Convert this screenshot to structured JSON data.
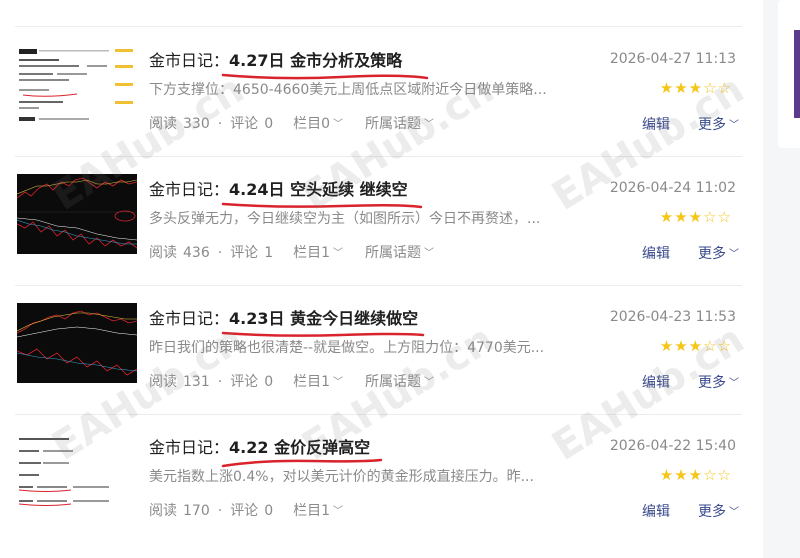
{
  "articles": [
    {
      "prefix": "金市日记：",
      "title_main": "4.27日 金市分析及策略",
      "datetime": "2026-04-27 11:13",
      "excerpt": "下方支撑位：4650-4660美元上周低点区域附近今日做单策略...",
      "rating": 3,
      "read_label": "阅读",
      "read_count": "330",
      "comment_label": "评论",
      "comment_count": "0",
      "category": "栏目0",
      "topic": "所属话题",
      "edit": "编辑",
      "more": "更多",
      "thumb_type": "text"
    },
    {
      "prefix": "金市日记：",
      "title_main": "4.24日 空头延续 继续空",
      "datetime": "2026-04-24 11:02",
      "excerpt": "多头反弹无力，今日继续空为主（如图所示）今日不再赘述，...",
      "rating": 3,
      "read_label": "阅读",
      "read_count": "436",
      "comment_label": "评论",
      "comment_count": "1",
      "category": "栏目1",
      "topic": "所属话题",
      "edit": "编辑",
      "more": "更多",
      "thumb_type": "chart"
    },
    {
      "prefix": "金市日记：",
      "title_main": "4.23日 黄金今日继续做空",
      "datetime": "2026-04-23 11:53",
      "excerpt": "昨日我们的策略也很清楚--就是做空。上方阻力位：4770美元...",
      "rating": 3,
      "read_label": "阅读",
      "read_count": "131",
      "comment_label": "评论",
      "comment_count": "0",
      "category": "栏目1",
      "topic": "所属话题",
      "edit": "编辑",
      "more": "更多",
      "thumb_type": "chart"
    },
    {
      "prefix": "金市日记：",
      "title_main": "4.22 金价反弹高空",
      "datetime": "2026-04-22 15:40",
      "excerpt": "美元指数上涨0.4%，对以美元计价的黄金形成直接压力。昨...",
      "rating": 3,
      "read_label": "阅读",
      "read_count": "170",
      "comment_label": "评论",
      "comment_count": "0",
      "category": "栏目1",
      "topic": "",
      "edit": "编辑",
      "more": "更多",
      "thumb_type": "text"
    }
  ],
  "watermark": "EAHub.cn",
  "colors": {
    "link": "#3a4a8c",
    "star": "#f5c518",
    "underline": "#d9232d",
    "muted": "#8a8a8a"
  }
}
